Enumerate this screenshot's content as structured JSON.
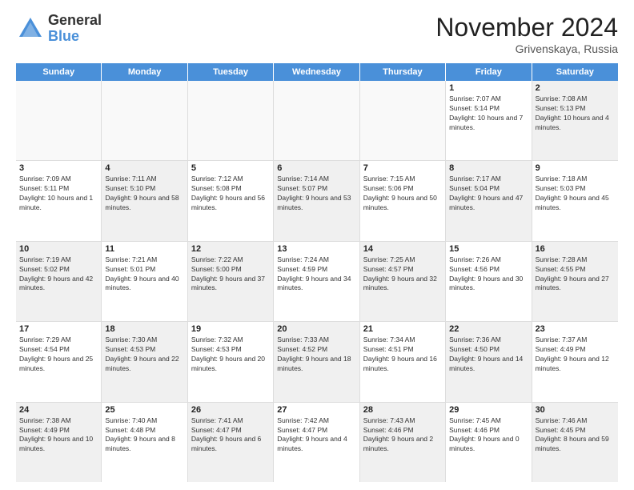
{
  "logo": {
    "general": "General",
    "blue": "Blue"
  },
  "header": {
    "month": "November 2024",
    "location": "Grivenskaya, Russia"
  },
  "days_of_week": [
    "Sunday",
    "Monday",
    "Tuesday",
    "Wednesday",
    "Thursday",
    "Friday",
    "Saturday"
  ],
  "rows": [
    [
      {
        "day": "",
        "empty": true
      },
      {
        "day": "",
        "empty": true
      },
      {
        "day": "",
        "empty": true
      },
      {
        "day": "",
        "empty": true
      },
      {
        "day": "",
        "empty": true
      },
      {
        "day": "1",
        "info": "Sunrise: 7:07 AM\nSunset: 5:14 PM\nDaylight: 10 hours and 7 minutes."
      },
      {
        "day": "2",
        "info": "Sunrise: 7:08 AM\nSunset: 5:13 PM\nDaylight: 10 hours and 4 minutes.",
        "shaded": true
      }
    ],
    [
      {
        "day": "3",
        "info": "Sunrise: 7:09 AM\nSunset: 5:11 PM\nDaylight: 10 hours and 1 minute."
      },
      {
        "day": "4",
        "info": "Sunrise: 7:11 AM\nSunset: 5:10 PM\nDaylight: 9 hours and 58 minutes.",
        "shaded": true
      },
      {
        "day": "5",
        "info": "Sunrise: 7:12 AM\nSunset: 5:08 PM\nDaylight: 9 hours and 56 minutes."
      },
      {
        "day": "6",
        "info": "Sunrise: 7:14 AM\nSunset: 5:07 PM\nDaylight: 9 hours and 53 minutes.",
        "shaded": true
      },
      {
        "day": "7",
        "info": "Sunrise: 7:15 AM\nSunset: 5:06 PM\nDaylight: 9 hours and 50 minutes."
      },
      {
        "day": "8",
        "info": "Sunrise: 7:17 AM\nSunset: 5:04 PM\nDaylight: 9 hours and 47 minutes.",
        "shaded": true
      },
      {
        "day": "9",
        "info": "Sunrise: 7:18 AM\nSunset: 5:03 PM\nDaylight: 9 hours and 45 minutes."
      }
    ],
    [
      {
        "day": "10",
        "info": "Sunrise: 7:19 AM\nSunset: 5:02 PM\nDaylight: 9 hours and 42 minutes.",
        "shaded": true
      },
      {
        "day": "11",
        "info": "Sunrise: 7:21 AM\nSunset: 5:01 PM\nDaylight: 9 hours and 40 minutes."
      },
      {
        "day": "12",
        "info": "Sunrise: 7:22 AM\nSunset: 5:00 PM\nDaylight: 9 hours and 37 minutes.",
        "shaded": true
      },
      {
        "day": "13",
        "info": "Sunrise: 7:24 AM\nSunset: 4:59 PM\nDaylight: 9 hours and 34 minutes."
      },
      {
        "day": "14",
        "info": "Sunrise: 7:25 AM\nSunset: 4:57 PM\nDaylight: 9 hours and 32 minutes.",
        "shaded": true
      },
      {
        "day": "15",
        "info": "Sunrise: 7:26 AM\nSunset: 4:56 PM\nDaylight: 9 hours and 30 minutes."
      },
      {
        "day": "16",
        "info": "Sunrise: 7:28 AM\nSunset: 4:55 PM\nDaylight: 9 hours and 27 minutes.",
        "shaded": true
      }
    ],
    [
      {
        "day": "17",
        "info": "Sunrise: 7:29 AM\nSunset: 4:54 PM\nDaylight: 9 hours and 25 minutes."
      },
      {
        "day": "18",
        "info": "Sunrise: 7:30 AM\nSunset: 4:53 PM\nDaylight: 9 hours and 22 minutes.",
        "shaded": true
      },
      {
        "day": "19",
        "info": "Sunrise: 7:32 AM\nSunset: 4:53 PM\nDaylight: 9 hours and 20 minutes."
      },
      {
        "day": "20",
        "info": "Sunrise: 7:33 AM\nSunset: 4:52 PM\nDaylight: 9 hours and 18 minutes.",
        "shaded": true
      },
      {
        "day": "21",
        "info": "Sunrise: 7:34 AM\nSunset: 4:51 PM\nDaylight: 9 hours and 16 minutes."
      },
      {
        "day": "22",
        "info": "Sunrise: 7:36 AM\nSunset: 4:50 PM\nDaylight: 9 hours and 14 minutes.",
        "shaded": true
      },
      {
        "day": "23",
        "info": "Sunrise: 7:37 AM\nSunset: 4:49 PM\nDaylight: 9 hours and 12 minutes."
      }
    ],
    [
      {
        "day": "24",
        "info": "Sunrise: 7:38 AM\nSunset: 4:49 PM\nDaylight: 9 hours and 10 minutes.",
        "shaded": true
      },
      {
        "day": "25",
        "info": "Sunrise: 7:40 AM\nSunset: 4:48 PM\nDaylight: 9 hours and 8 minutes."
      },
      {
        "day": "26",
        "info": "Sunrise: 7:41 AM\nSunset: 4:47 PM\nDaylight: 9 hours and 6 minutes.",
        "shaded": true
      },
      {
        "day": "27",
        "info": "Sunrise: 7:42 AM\nSunset: 4:47 PM\nDaylight: 9 hours and 4 minutes."
      },
      {
        "day": "28",
        "info": "Sunrise: 7:43 AM\nSunset: 4:46 PM\nDaylight: 9 hours and 2 minutes.",
        "shaded": true
      },
      {
        "day": "29",
        "info": "Sunrise: 7:45 AM\nSunset: 4:46 PM\nDaylight: 9 hours and 0 minutes."
      },
      {
        "day": "30",
        "info": "Sunrise: 7:46 AM\nSunset: 4:45 PM\nDaylight: 8 hours and 59 minutes.",
        "shaded": true
      }
    ]
  ]
}
